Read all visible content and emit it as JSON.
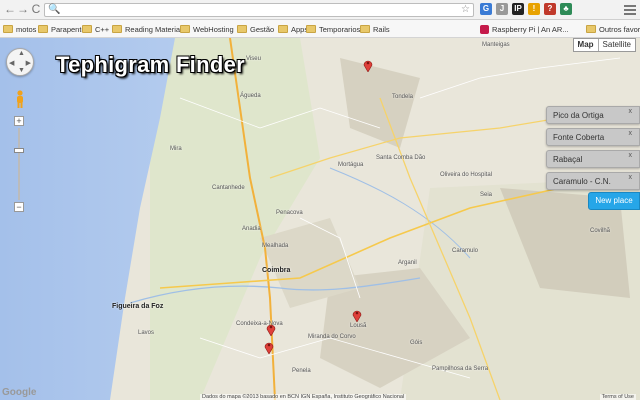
{
  "browser": {
    "back_icon": "←",
    "forward_icon": "→",
    "reload_icon": "C",
    "search_icon": "🔍",
    "star_icon": "☆",
    "url": "",
    "extensions": [
      {
        "label": "G",
        "color": "#3a7bd5"
      },
      {
        "label": "J",
        "color": "#999999"
      },
      {
        "label": "IP",
        "color": "#222222"
      },
      {
        "label": "!",
        "color": "#e8a200"
      },
      {
        "label": "?",
        "color": "#c0392b"
      },
      {
        "label": "♣",
        "color": "#2e8b57"
      }
    ]
  },
  "bookmarks": [
    {
      "label": "motos",
      "kind": "folder"
    },
    {
      "label": "Parapente",
      "kind": "folder"
    },
    {
      "label": "C++",
      "kind": "folder"
    },
    {
      "label": "Reading Material",
      "kind": "folder"
    },
    {
      "label": "WebHosting",
      "kind": "folder"
    },
    {
      "label": "Gestão",
      "kind": "folder"
    },
    {
      "label": "Apps",
      "kind": "folder"
    },
    {
      "label": "Temporarios",
      "kind": "folder"
    },
    {
      "label": "Rails",
      "kind": "folder"
    },
    {
      "label": "Raspberry Pi | An AR...",
      "kind": "link"
    },
    {
      "label": "Outros favoritos",
      "kind": "folder"
    }
  ],
  "map": {
    "title": "Tephigram Finder",
    "pan_icon": "pan-control",
    "zoom_in": "+",
    "zoom_out": "−",
    "type_map": "Map",
    "type_satellite": "Satellite",
    "google": "Google",
    "copyright": "Dados do mapa ©2013 basado en BCN IGN España, Instituto Geográfico Nacional",
    "terms": "Terms of Use",
    "labels": [
      {
        "text": "Manteigas",
        "cls": "map-label"
      },
      {
        "text": "Arganil",
        "cls": "map-label"
      },
      {
        "text": "Coimbra",
        "cls": "map-label city"
      },
      {
        "text": "Figueira da Foz",
        "cls": "map-label city"
      },
      {
        "text": "Viseu",
        "cls": "map-label"
      },
      {
        "text": "Santa Comba Dão",
        "cls": "map-label"
      },
      {
        "text": "Tondela",
        "cls": "map-label"
      },
      {
        "text": "Mortágua",
        "cls": "map-label"
      },
      {
        "text": "Penacova",
        "cls": "map-label"
      },
      {
        "text": "Cantanhede",
        "cls": "map-label"
      },
      {
        "text": "Mira",
        "cls": "map-label"
      },
      {
        "text": "Anadia",
        "cls": "map-label"
      },
      {
        "text": "Mealhada",
        "cls": "map-label"
      },
      {
        "text": "Águeda",
        "cls": "map-label"
      },
      {
        "text": "Lousã",
        "cls": "map-label"
      },
      {
        "text": "Miranda do Corvo",
        "cls": "map-label"
      },
      {
        "text": "Condeixa-a-Nova",
        "cls": "map-label"
      },
      {
        "text": "Penela",
        "cls": "map-label"
      },
      {
        "text": "Seia",
        "cls": "map-label"
      },
      {
        "text": "Oliveira do Hospital",
        "cls": "map-label"
      },
      {
        "text": "Covilhã",
        "cls": "map-label"
      },
      {
        "text": "Pampilhosa da Serra",
        "cls": "map-label"
      },
      {
        "text": "Góis",
        "cls": "map-label"
      },
      {
        "text": "Lavos",
        "cls": "map-label"
      },
      {
        "text": "Caramulo",
        "cls": "map-label"
      }
    ]
  },
  "places": [
    {
      "name": "Pico da Ortiga",
      "close": "x"
    },
    {
      "name": "Fonte Coberta",
      "close": "x"
    },
    {
      "name": "Rabaçal",
      "close": "x"
    },
    {
      "name": "Caramulo - C.N.",
      "close": "x"
    }
  ],
  "new_place": "New place"
}
